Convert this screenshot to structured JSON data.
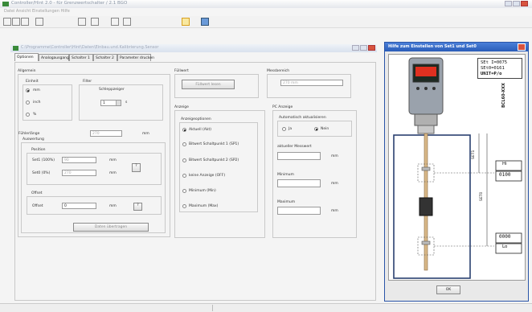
{
  "app": {
    "title": "Controller/Hint 2.0 - für Grenzwertschalter / 2.1 BGO",
    "menu": "Datei  Ansicht  Einstellungen  Hilfe"
  },
  "inner_window": {
    "title": "C:\\Programme\\Controller\\Hint\\Daten\\Einbau.und.Kalibrierung.Sensor"
  },
  "tabs": [
    "Optionen",
    "Analogausgang",
    "Schalter 1",
    "Schalter 2",
    "Parameter drucken"
  ],
  "allgemein": {
    "title": "Allgemein",
    "einheit": {
      "title": "Einheit",
      "options": [
        "mm",
        "inch",
        "%"
      ],
      "selected": 0
    },
    "filter": {
      "title": "Filter",
      "label": "Schleppzeiger",
      "value": "1",
      "unit": "s"
    },
    "fuehlerlaenge": {
      "label": "Fühlerlänge",
      "value": "270",
      "unit": "mm"
    }
  },
  "auswertung": {
    "title": "Auswertung",
    "position": {
      "title": "Position",
      "set1_label": "Set1 (100%)",
      "set1_value": "90",
      "set0_label": "Set0 (0%)",
      "set0_value": "270",
      "unit": "mm",
      "help_label": "?"
    },
    "offset": {
      "title": "Offset",
      "label": "Offset",
      "value": "0",
      "unit": "mm",
      "help_label": "?"
    },
    "apply_button": "Daten übertragen"
  },
  "fuellwert": {
    "title": "Füllwert",
    "button": "Füllwert lesen"
  },
  "messbereich": {
    "title": "Messbereich",
    "value": "270 mm"
  },
  "anzeige": {
    "title": "Anzeige",
    "sub_title": "Anzeigeoptionen",
    "options": [
      "Aktuell (Akt)",
      "Bitwert Schaltpunkt 1 (SP1)",
      "Bitwert Schaltpunkt 2 (SP2)",
      "keine Anzeige (OFF)",
      "Minimum (Min)",
      "Maximum (Max)"
    ],
    "selected": 0
  },
  "pc_anzeige": {
    "title": "PC Anzeige",
    "auto_title": "Automatisch aktualisieren",
    "ja": "Ja",
    "nein": "Nein",
    "selected": "nein",
    "aktuell_label": "aktueller Messwert",
    "minimum_label": "Minimum",
    "maximum_label": "Maximum",
    "unit": "mm"
  },
  "help_window": {
    "title": "Hilfe zum Einstellen von Set1 und Set0",
    "display_lines": [
      "SEt I=0075",
      "SEt0=0161",
      "UNIT=P/o"
    ],
    "model": "BCL60-XXX",
    "set1": "SET1",
    "set0": "SET0",
    "value_high": "0100",
    "value_low": "0000",
    "high_symbol": "Hi",
    "low_symbol": "Lo",
    "ok": "OK"
  },
  "colors": {
    "help_titlebar": "#2f63c0",
    "sensor_body": "#9aa2ac",
    "display_red": "#e03020"
  }
}
